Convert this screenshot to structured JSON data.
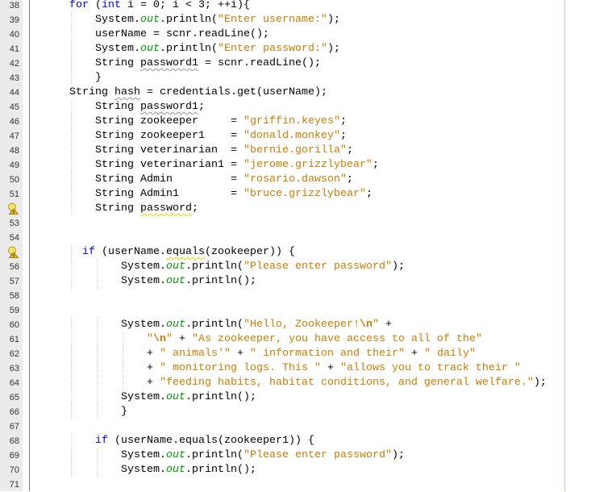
{
  "editor": {
    "colors": {
      "keyword": "#0000e6",
      "string": "#ce7b00",
      "field": "#009900",
      "gutter": "#ebebeb",
      "margin": "#f2b8b8"
    },
    "lines": [
      {
        "num": "38",
        "indent": 6,
        "tokens": [
          [
            "k",
            "for"
          ],
          [
            "t",
            " ("
          ],
          [
            "k",
            "int"
          ],
          [
            "t",
            " i = 0; i < 3; ++i){"
          ]
        ]
      },
      {
        "num": "39",
        "indent": 10,
        "tokens": [
          [
            "t",
            "System."
          ],
          [
            "o",
            "out"
          ],
          [
            "t",
            ".println("
          ],
          [
            "s",
            "\"Enter username:\""
          ],
          [
            "t",
            ");"
          ]
        ]
      },
      {
        "num": "40",
        "indent": 10,
        "tokens": [
          [
            "t",
            "userName = scnr.readLine();"
          ]
        ]
      },
      {
        "num": "41",
        "indent": 10,
        "tokens": [
          [
            "t",
            "System."
          ],
          [
            "o",
            "out"
          ],
          [
            "t",
            ".println("
          ],
          [
            "s",
            "\"Enter password:\""
          ],
          [
            "t",
            ");"
          ]
        ]
      },
      {
        "num": "42",
        "indent": 10,
        "tokens": [
          [
            "t",
            "String "
          ],
          [
            "u",
            "password1"
          ],
          [
            "t",
            " = scnr.readLine();"
          ]
        ]
      },
      {
        "num": "43",
        "indent": 10,
        "tokens": [
          [
            "t",
            "}"
          ]
        ]
      },
      {
        "num": "44",
        "indent": 6,
        "tokens": [
          [
            "t",
            "String "
          ],
          [
            "u",
            "hash"
          ],
          [
            "t",
            " = credentials.get(userName);"
          ]
        ]
      },
      {
        "num": "45",
        "indent": 10,
        "tokens": [
          [
            "t",
            "String "
          ],
          [
            "u",
            "password1"
          ],
          [
            "t",
            ";"
          ]
        ]
      },
      {
        "num": "46",
        "indent": 10,
        "tokens": [
          [
            "t",
            "String zookeeper     = "
          ],
          [
            "s",
            "\"griffin.keyes\""
          ],
          [
            "t",
            ";"
          ]
        ]
      },
      {
        "num": "47",
        "indent": 10,
        "tokens": [
          [
            "t",
            "String zookeeper1    = "
          ],
          [
            "s",
            "\"donald.monkey\""
          ],
          [
            "t",
            ";"
          ]
        ]
      },
      {
        "num": "48",
        "indent": 10,
        "tokens": [
          [
            "t",
            "String veterinarian  = "
          ],
          [
            "s",
            "\"bernie.gorilla\""
          ],
          [
            "t",
            ";"
          ]
        ]
      },
      {
        "num": "49",
        "indent": 10,
        "tokens": [
          [
            "t",
            "String veterinarian1 = "
          ],
          [
            "s",
            "\"jerome.grizzlybear\""
          ],
          [
            "t",
            ";"
          ]
        ]
      },
      {
        "num": "50",
        "indent": 10,
        "tokens": [
          [
            "t",
            "String Admin         = "
          ],
          [
            "s",
            "\"rosario.dawson\""
          ],
          [
            "t",
            ";"
          ]
        ]
      },
      {
        "num": "51",
        "indent": 10,
        "tokens": [
          [
            "t",
            "String Admin1        = "
          ],
          [
            "s",
            "\"bruce.grizzlybear\""
          ],
          [
            "t",
            ";"
          ]
        ]
      },
      {
        "num": "52",
        "hint": "warning-hint",
        "indent": 10,
        "tokens": [
          [
            "t",
            "String "
          ],
          [
            "w",
            "password"
          ],
          [
            "t",
            ";"
          ]
        ]
      },
      {
        "num": "53",
        "indent": 0,
        "tokens": []
      },
      {
        "num": "54",
        "indent": 0,
        "tokens": []
      },
      {
        "num": "55",
        "hint": "warning-hint",
        "indent": 8,
        "tokens": [
          [
            "k",
            "if"
          ],
          [
            "t",
            " (userName."
          ],
          [
            "w",
            "equals"
          ],
          [
            "t",
            "(zookeeper)) {"
          ]
        ]
      },
      {
        "num": "56",
        "indent": 14,
        "tokens": [
          [
            "t",
            "System."
          ],
          [
            "o",
            "out"
          ],
          [
            "t",
            ".println("
          ],
          [
            "s",
            "\"Please enter password\""
          ],
          [
            "t",
            ");"
          ]
        ]
      },
      {
        "num": "57",
        "indent": 14,
        "tokens": [
          [
            "t",
            "System."
          ],
          [
            "o",
            "out"
          ],
          [
            "t",
            ".println();"
          ]
        ]
      },
      {
        "num": "58",
        "indent": 0,
        "tokens": []
      },
      {
        "num": "59",
        "indent": 0,
        "tokens": []
      },
      {
        "num": "60",
        "indent": 14,
        "tokens": [
          [
            "t",
            "System."
          ],
          [
            "o",
            "out"
          ],
          [
            "t",
            ".println("
          ],
          [
            "s",
            "\"Hello, Zookeeper!"
          ],
          [
            "e",
            "\\n"
          ],
          [
            "s",
            "\""
          ],
          [
            "t",
            " +"
          ]
        ]
      },
      {
        "num": "61",
        "indent": 18,
        "tokens": [
          [
            "s",
            "\""
          ],
          [
            "e",
            "\\n"
          ],
          [
            "s",
            "\""
          ],
          [
            "t",
            " + "
          ],
          [
            "s",
            "\"As zookeeper, you have access to all of the\""
          ]
        ]
      },
      {
        "num": "62",
        "indent": 18,
        "tokens": [
          [
            "t",
            "+ "
          ],
          [
            "s",
            "\" animals'\""
          ],
          [
            "t",
            " + "
          ],
          [
            "s",
            "\" information and their\""
          ],
          [
            "t",
            " + "
          ],
          [
            "s",
            "\" daily\""
          ]
        ]
      },
      {
        "num": "63",
        "indent": 18,
        "tokens": [
          [
            "t",
            "+ "
          ],
          [
            "s",
            "\" monitoring logs. This \""
          ],
          [
            "t",
            " + "
          ],
          [
            "s",
            "\"allows you to track their \""
          ]
        ]
      },
      {
        "num": "64",
        "indent": 18,
        "tokens": [
          [
            "t",
            "+ "
          ],
          [
            "s",
            "\"feeding habits, habitat conditions, and general welfare.\""
          ],
          [
            "t",
            ");"
          ]
        ]
      },
      {
        "num": "65",
        "indent": 14,
        "tokens": [
          [
            "t",
            "System."
          ],
          [
            "o",
            "out"
          ],
          [
            "t",
            ".println();"
          ]
        ]
      },
      {
        "num": "66",
        "indent": 14,
        "tokens": [
          [
            "t",
            "}"
          ]
        ]
      },
      {
        "num": "67",
        "indent": 0,
        "tokens": []
      },
      {
        "num": "68",
        "indent": 10,
        "tokens": [
          [
            "k",
            "if"
          ],
          [
            "t",
            " (userName.equals(zookeeper1)) {"
          ]
        ]
      },
      {
        "num": "69",
        "indent": 14,
        "tokens": [
          [
            "t",
            "System."
          ],
          [
            "o",
            "out"
          ],
          [
            "t",
            ".println("
          ],
          [
            "s",
            "\"Please enter password\""
          ],
          [
            "t",
            ");"
          ]
        ]
      },
      {
        "num": "70",
        "indent": 14,
        "tokens": [
          [
            "t",
            "System."
          ],
          [
            "o",
            "out"
          ],
          [
            "t",
            ".println();"
          ]
        ]
      },
      {
        "num": "71",
        "indent": 0,
        "tokens": []
      }
    ]
  }
}
